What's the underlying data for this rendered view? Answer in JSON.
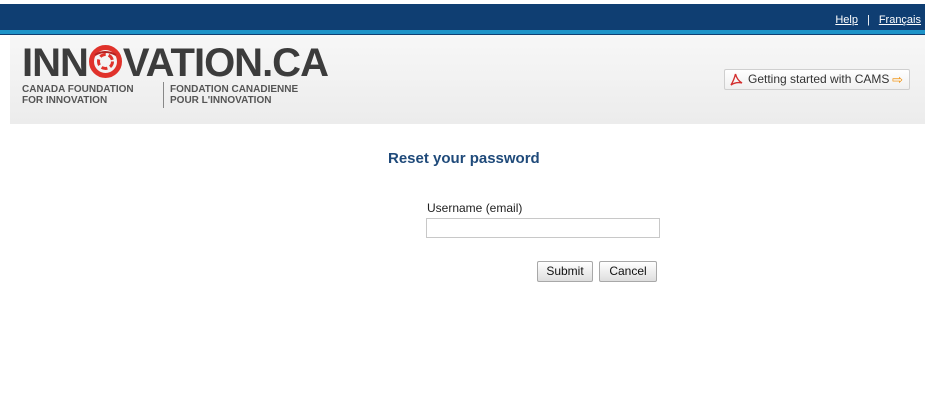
{
  "topbar": {
    "help_link": "Help",
    "separator": "|",
    "language_link": "Français"
  },
  "logo": {
    "brand_prefix": "INN",
    "brand_suffix": "VATION.CA",
    "english_line1": "CANADA FOUNDATION",
    "english_line2": "FOR INNOVATION",
    "french_line1": "FONDATION CANADIENNE",
    "french_line2": "POUR L'INNOVATION"
  },
  "header": {
    "guide_button_label": "Getting started with CAMS",
    "guide_icon": "pdf-icon",
    "guide_arrow_icon": "arrow-right-icon"
  },
  "form": {
    "title": "Reset your password",
    "username_label": "Username (email)",
    "username_value": "",
    "submit_label": "Submit",
    "cancel_label": "Cancel"
  },
  "colors": {
    "topbar": "#0f3e72",
    "accent": "#1d93c8",
    "title": "#1f4a7a",
    "logo_mark": "#e0322b",
    "arrow": "#f08c00"
  }
}
